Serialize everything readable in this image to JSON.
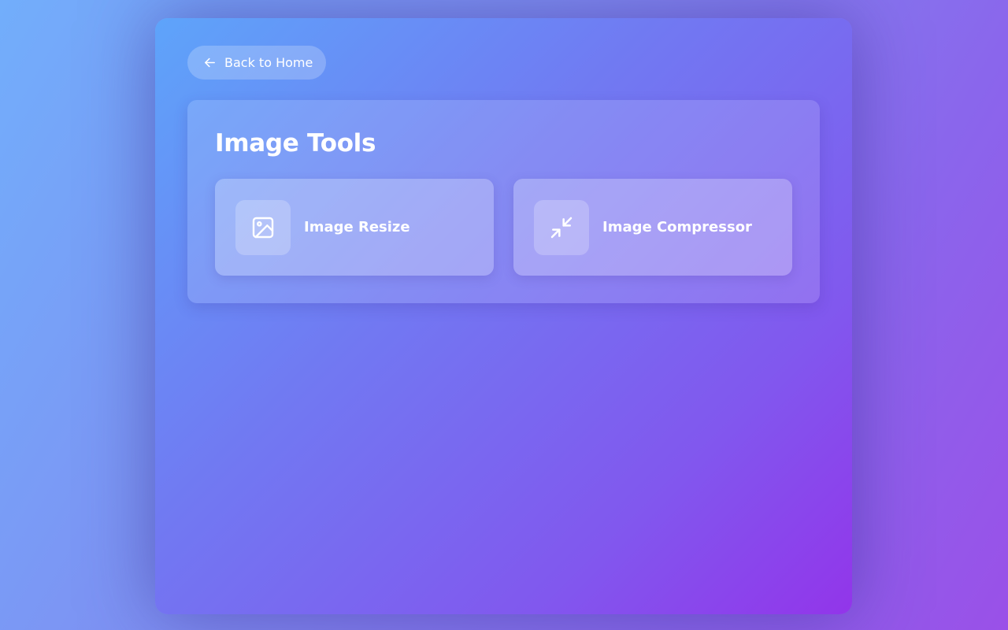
{
  "nav": {
    "back_label": "Back to Home",
    "back_icon": "arrow-left-icon"
  },
  "section": {
    "title": "Image Tools",
    "tools": [
      {
        "label": "Image Resize",
        "icon": "image-icon"
      },
      {
        "label": "Image Compressor",
        "icon": "minimize-arrows-icon"
      }
    ]
  },
  "colors": {
    "background_start": "#72aefb",
    "background_end": "#9a50e8",
    "shell_start": "#5ea4fa",
    "shell_end": "#9235ea",
    "text": "#ffffff"
  }
}
